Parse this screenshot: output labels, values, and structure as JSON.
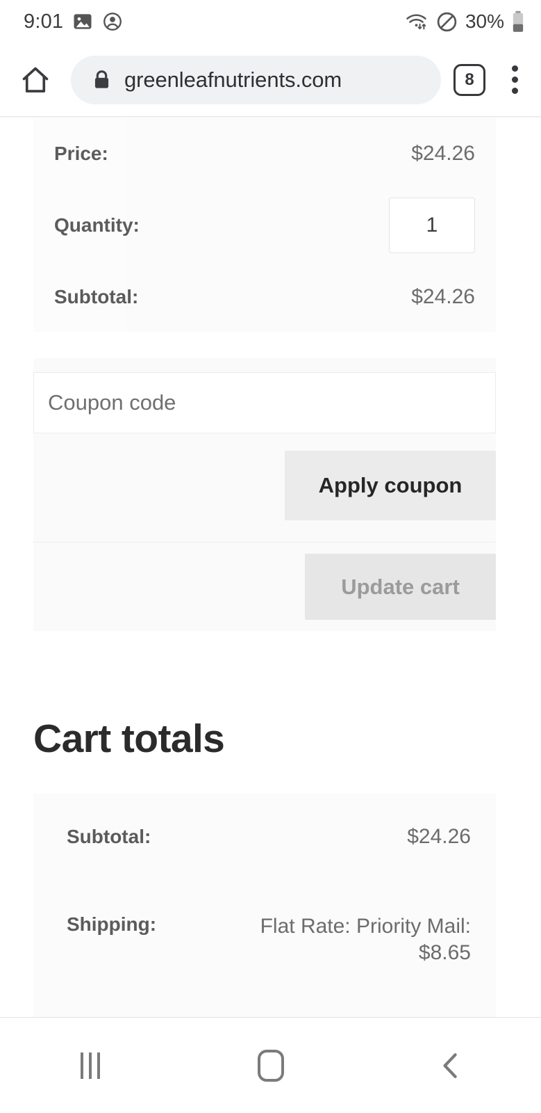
{
  "status_bar": {
    "time": "9:01",
    "battery_percent": "30%",
    "icons": [
      "photo-icon",
      "account-icon",
      "wifi-icon",
      "do-not-disturb-icon",
      "battery-icon"
    ]
  },
  "browser": {
    "home_icon": "home-icon",
    "lock_icon": "lock-icon",
    "url": "greenleafnutrients.com",
    "tab_count": "8",
    "menu_icon": "overflow-menu-icon"
  },
  "cart": {
    "product_rows": [
      {
        "label": "Price:",
        "value": "$24.26"
      },
      {
        "label": "Quantity:",
        "value": "1"
      },
      {
        "label": "Subtotal:",
        "value": "$24.26"
      }
    ],
    "quantity_value": "1",
    "coupon": {
      "placeholder": "Coupon code",
      "value": "",
      "apply_label": "Apply coupon",
      "update_label": "Update cart"
    },
    "totals": {
      "title": "Cart totals",
      "rows": [
        {
          "label": "Subtotal:",
          "value": "$24.26"
        },
        {
          "label": "Shipping:",
          "value": "Flat Rate: Priority Mail: $8.65"
        }
      ]
    }
  },
  "nav_bar": {
    "recents": "recents-icon",
    "home": "home-icon",
    "back": "back-icon"
  }
}
